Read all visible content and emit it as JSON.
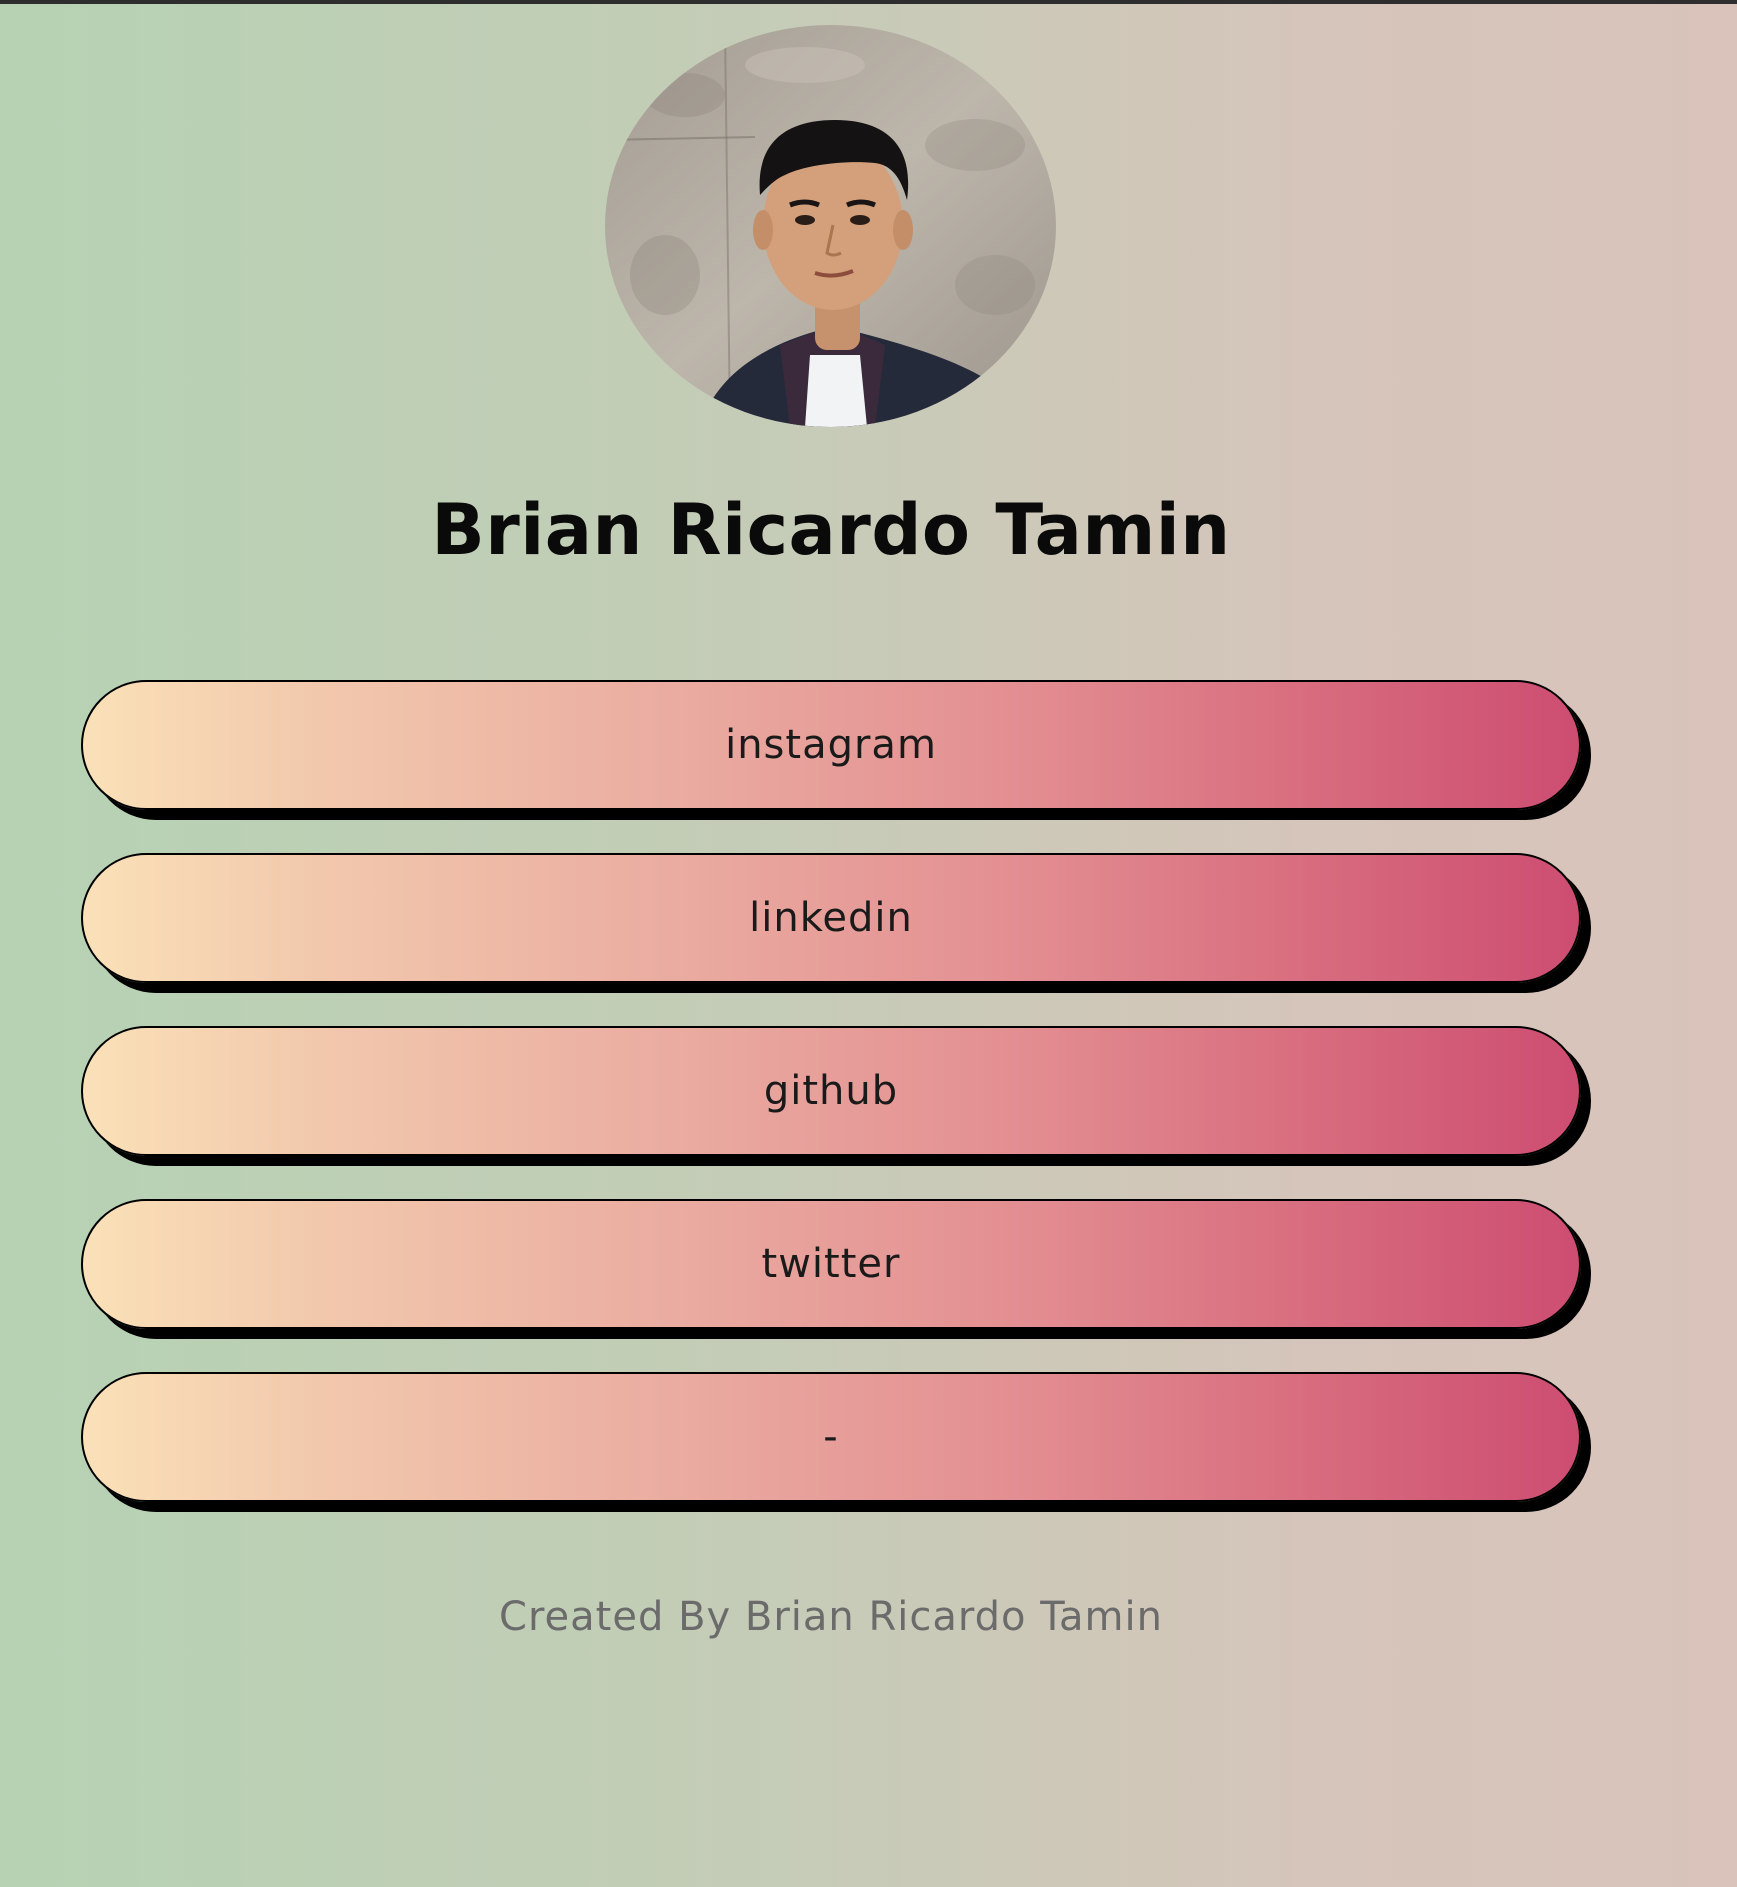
{
  "profile": {
    "name": "Brian Ricardo Tamin",
    "avatar_alt": "profile photo"
  },
  "links": [
    {
      "label": "instagram"
    },
    {
      "label": "linkedin"
    },
    {
      "label": "github"
    },
    {
      "label": "twitter"
    },
    {
      "label": "-"
    }
  ],
  "footer": {
    "text": "Created By Brian Ricardo Tamin"
  },
  "colors": {
    "background_left": "#b6d2b3",
    "background_right": "#d9c3bb",
    "button_left": "#fae1b8",
    "button_right": "#cd4d71",
    "button_shadow": "#000000"
  }
}
